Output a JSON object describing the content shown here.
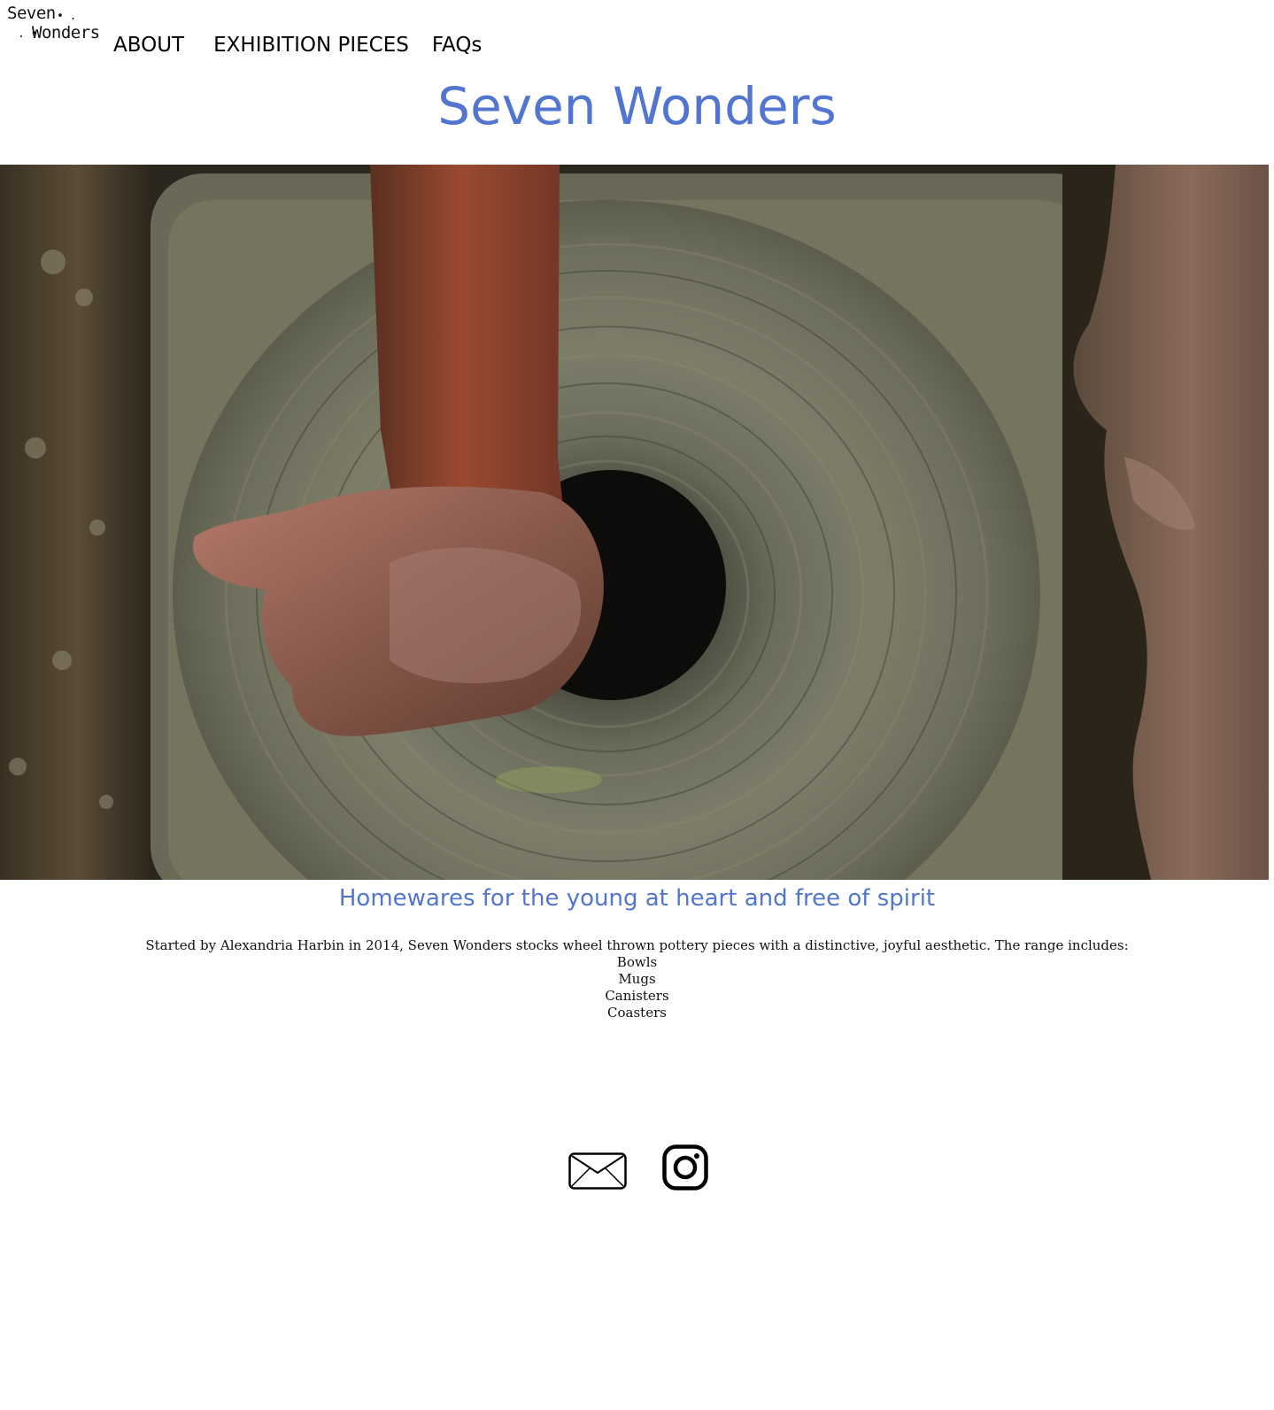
{
  "brand": {
    "logo_line1": "Seven",
    "logo_line2": "Wonders",
    "logo_dots_1": "• .",
    "logo_dots_2": ". •"
  },
  "nav": {
    "items": [
      {
        "label": "ABOUT"
      },
      {
        "label": "EXHIBITION PIECES"
      },
      {
        "label": "FAQs"
      }
    ]
  },
  "header": {
    "title": "Seven Wonders"
  },
  "hero": {
    "image_icon": "pottery-wheel-image"
  },
  "main": {
    "tagline": "Homewares for the young at heart and free of spirit",
    "intro": "Started by Alexandria Harbin in 2014, Seven Wonders stocks wheel thrown pottery pieces with a distinctive, joyful aesthetic. The range includes:",
    "range": [
      "Bowls",
      "Mugs",
      "Canisters",
      "Coasters"
    ]
  },
  "social": {
    "email_icon": "envelope-icon",
    "instagram_icon": "instagram-icon"
  },
  "colors": {
    "accent": "#5276d0",
    "text": "#000000",
    "background": "#ffffff"
  }
}
